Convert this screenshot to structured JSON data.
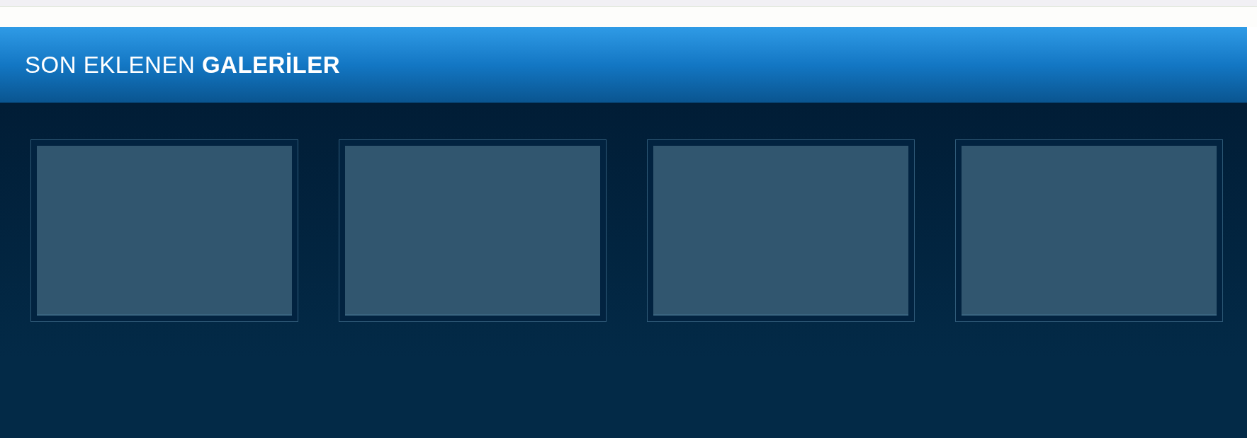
{
  "section": {
    "title": "SON EKLENEN **GALERİLER**"
  },
  "galleries": [
    {
      "kind": "empty"
    },
    {
      "kind": "empty"
    },
    {
      "kind": "empty"
    },
    {
      "kind": "empty"
    }
  ]
}
